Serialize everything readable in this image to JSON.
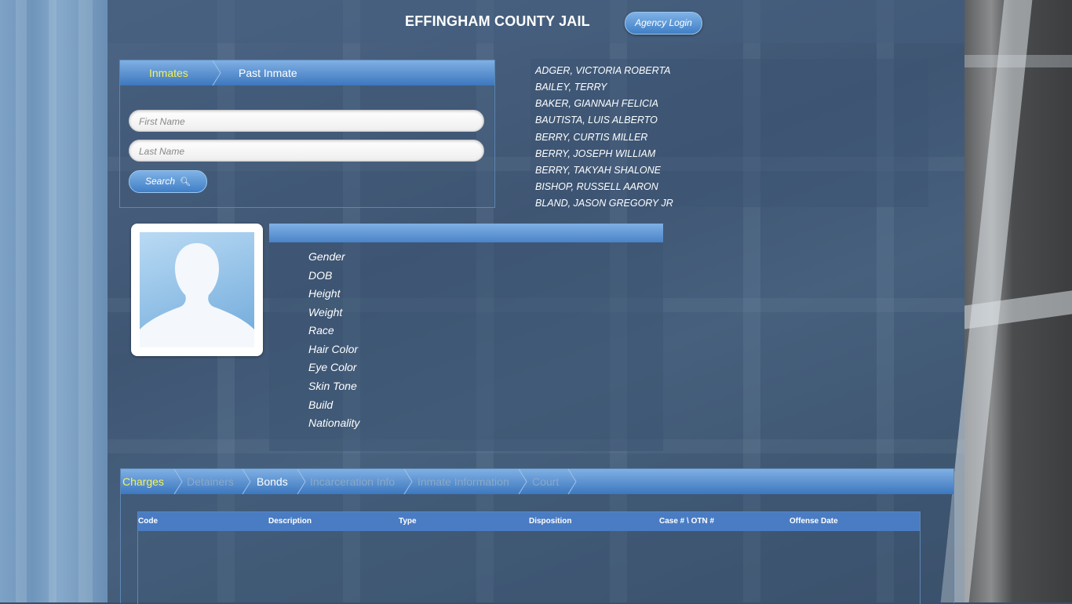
{
  "header": {
    "site_title": "EFFINGHAM COUNTY JAIL",
    "agency_login_label": "Agency Login"
  },
  "search_panel": {
    "tabs": [
      {
        "label": "Inmates",
        "active": true
      },
      {
        "label": "Past Inmate",
        "active": false
      }
    ],
    "first_name_placeholder": "First Name",
    "last_name_placeholder": "Last Name",
    "search_label": "Search",
    "search_icon": "search-icon"
  },
  "inmate_list": [
    "ADGER, VICTORIA ROBERTA",
    "BAILEY, TERRY",
    "BAKER, GIANNAH FELICIA",
    "BAUTISTA, LUIS ALBERTO",
    "BERRY, CURTIS MILLER",
    "BERRY, JOSEPH WILLIAM",
    "BERRY, TAKYAH SHALONE",
    "BISHOP, RUSSELL AARON",
    "BLAND, JASON GREGORY JR"
  ],
  "details": {
    "labels": [
      "Gender",
      "DOB",
      "Height",
      "Weight",
      "Race",
      "Hair Color",
      "Eye Color",
      "Skin Tone",
      "Build",
      "Nationality"
    ]
  },
  "bottom_tabs": [
    {
      "label": "Charges",
      "state": "active"
    },
    {
      "label": "Detainers",
      "state": "dim"
    },
    {
      "label": "Bonds",
      "state": "white"
    },
    {
      "label": "Incarceration Info",
      "state": "dim"
    },
    {
      "label": "Inmate Information",
      "state": "dim"
    },
    {
      "label": "Court",
      "state": "dim"
    }
  ],
  "charges_table": {
    "columns": [
      "Code",
      "Description",
      "Type",
      "Disposition",
      "Case # \\ OTN #",
      "Offense Date"
    ]
  },
  "colors": {
    "active_tab_text": "#f2f25a",
    "tab_bar_blue": "#3d77be",
    "table_header_blue": "#4a7cc4"
  }
}
